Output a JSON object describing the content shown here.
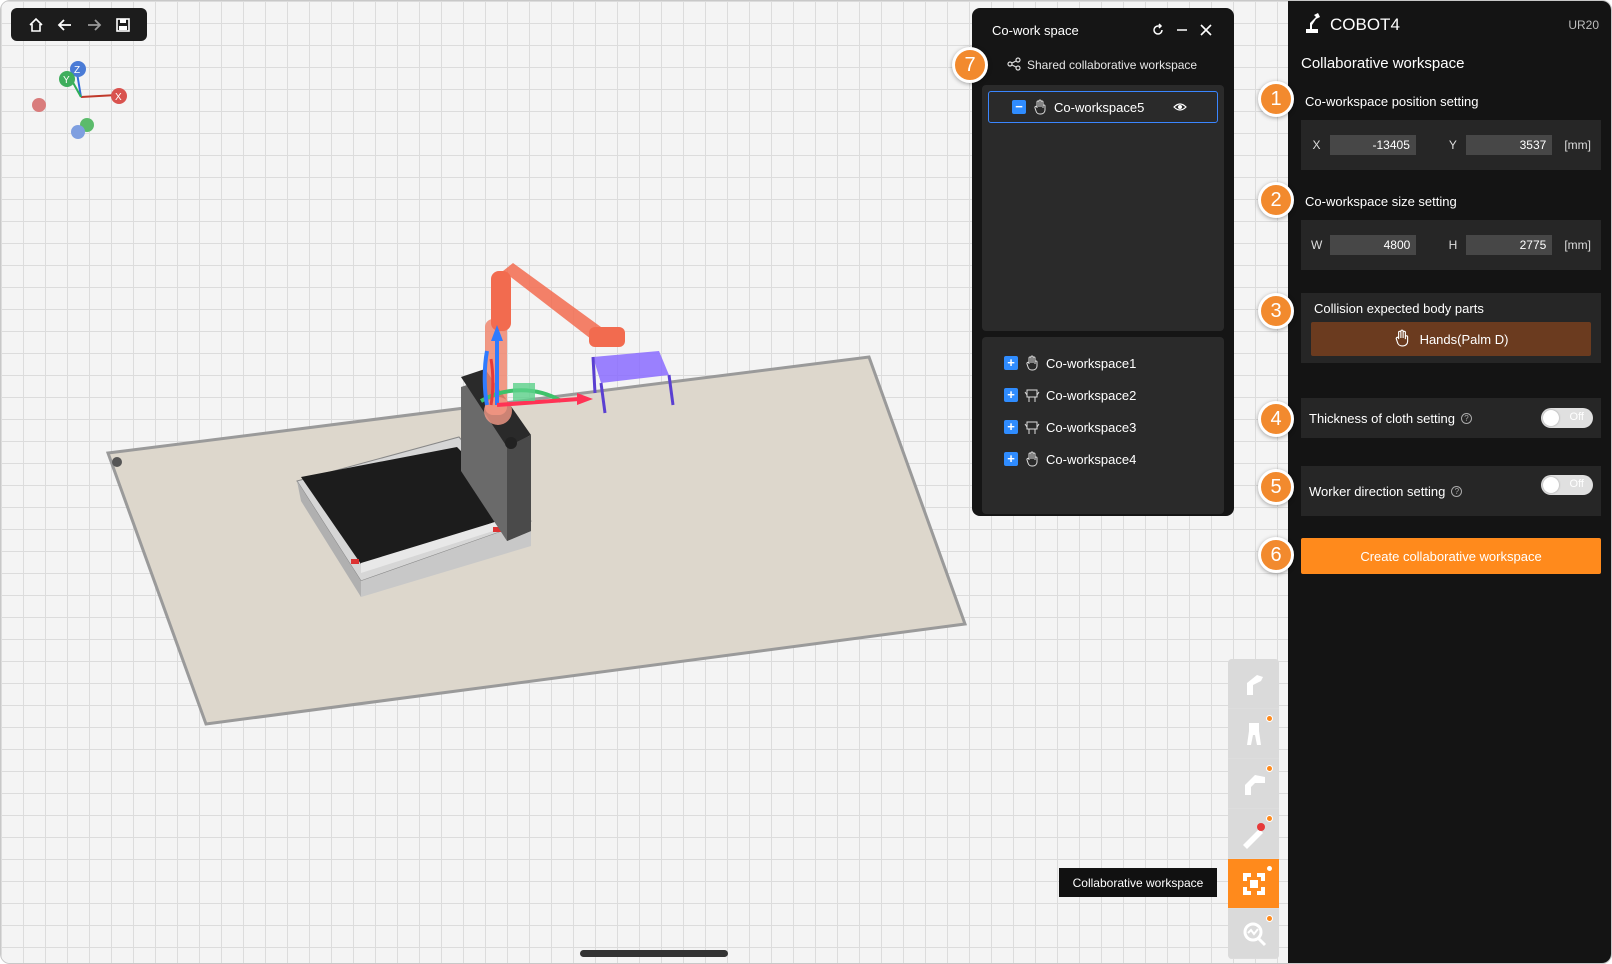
{
  "toolbar": {
    "icons": [
      "home-icon",
      "back-arrow-icon",
      "forward-arrow-icon",
      "save-icon"
    ]
  },
  "axis_gizmo": {
    "x": "X",
    "y": "Y",
    "z": "Z"
  },
  "cowork_panel": {
    "title": "Co-work space",
    "shared_label": "Shared collaborative workspace",
    "selected_workspace": "Co-workspace5",
    "workspaces": [
      {
        "label": "Co-workspace1",
        "icon": "hand-icon"
      },
      {
        "label": "Co-workspace2",
        "icon": "body-icon"
      },
      {
        "label": "Co-workspace3",
        "icon": "body-icon"
      },
      {
        "label": "Co-workspace4",
        "icon": "hand-icon"
      }
    ]
  },
  "right_panel": {
    "brand": "COBOT4",
    "model": "UR20",
    "subtitle": "Collaborative workspace",
    "position": {
      "label": "Co-workspace position setting",
      "x_label": "X",
      "x_value": "-13405",
      "y_label": "Y",
      "y_value": "3537",
      "unit": "[mm]"
    },
    "size": {
      "label": "Co-workspace size setting",
      "w_label": "W",
      "w_value": "4800",
      "h_label": "H",
      "h_value": "2775",
      "unit": "[mm]"
    },
    "collision": {
      "label": "Collision expected body parts",
      "button": "Hands(Palm D)"
    },
    "cloth": {
      "label": "Thickness of cloth setting",
      "toggle": "Off"
    },
    "worker_dir": {
      "label": "Worker direction setting",
      "toggle": "Off"
    },
    "create_button": "Create collaborative workspace"
  },
  "callouts": [
    "1",
    "2",
    "3",
    "4",
    "5",
    "6",
    "7"
  ],
  "tooltip": "Collaborative workspace",
  "colors": {
    "accent": "#ff8a1c",
    "panel_bg": "#141414",
    "selection_blue": "#3a86ff",
    "callout": "#f28a2e"
  }
}
